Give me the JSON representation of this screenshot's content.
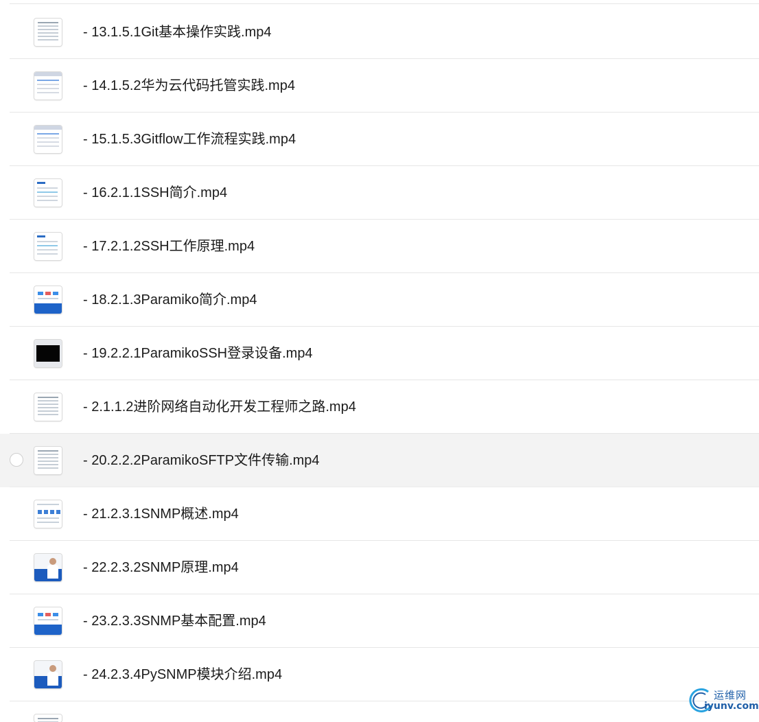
{
  "files": [
    {
      "label": "- 13.1.5.1Git基本操作实践.mp4",
      "thumb": "th-doc",
      "selected": false
    },
    {
      "label": "- 14.1.5.2华为云代码托管实践.mp4",
      "thumb": "th-web",
      "selected": false
    },
    {
      "label": "- 15.1.5.3Gitflow工作流程实践.mp4",
      "thumb": "th-web",
      "selected": false
    },
    {
      "label": "- 16.2.1.1SSH简介.mp4",
      "thumb": "th-slide",
      "selected": false
    },
    {
      "label": "- 17.2.1.2SSH工作原理.mp4",
      "thumb": "th-slide",
      "selected": false
    },
    {
      "label": "- 18.2.1.3Paramiko简介.mp4",
      "thumb": "th-blue",
      "selected": false
    },
    {
      "label": "- 19.2.2.1ParamikoSSH登录设备.mp4",
      "thumb": "th-term",
      "selected": false
    },
    {
      "label": "- 2.1.1.2进阶网络自动化开发工程师之路.mp4",
      "thumb": "th-doc",
      "selected": false
    },
    {
      "label": "- 20.2.2.2ParamikoSFTP文件传输.mp4",
      "thumb": "th-doc",
      "selected": true
    },
    {
      "label": "- 21.2.3.1SNMP概述.mp4",
      "thumb": "th-grid",
      "selected": false
    },
    {
      "label": "- 22.2.3.2SNMP原理.mp4",
      "thumb": "th-person",
      "selected": false
    },
    {
      "label": "- 23.2.3.3SNMP基本配置.mp4",
      "thumb": "th-blue",
      "selected": false
    },
    {
      "label": "- 24.2.3.4PySNMP模块介绍.mp4",
      "thumb": "th-person",
      "selected": false
    }
  ],
  "watermark": {
    "cn": "运维网",
    "en": "iyunv.com"
  },
  "colors": {
    "selected_row": "#f3f3f3",
    "separator": "#e6e6e6",
    "text": "#1b1b1b",
    "watermark": "#1f5fa8"
  }
}
